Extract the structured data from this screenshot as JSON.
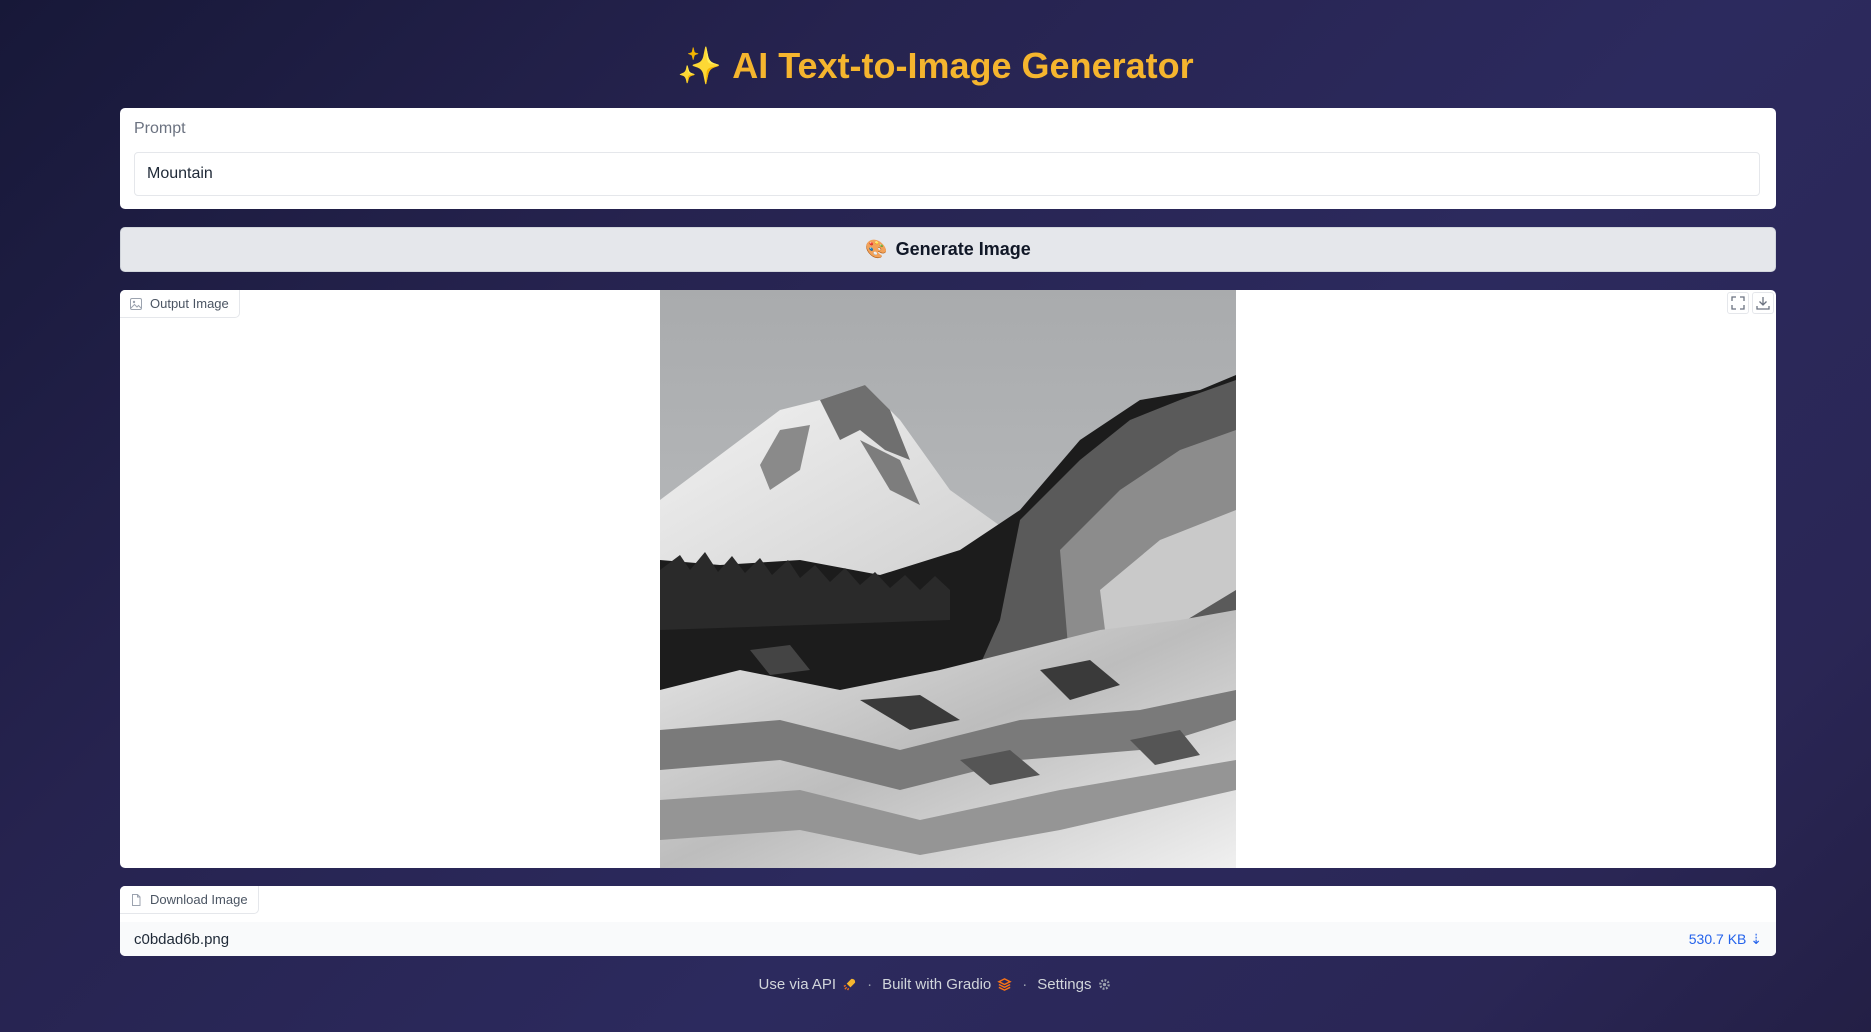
{
  "header": {
    "icon": "sparkles-icon",
    "sparkle": "✨",
    "title": "AI Text-to-Image Generator",
    "title_color": "#f5b52e"
  },
  "prompt": {
    "label": "Prompt",
    "value": "Mountain"
  },
  "generate": {
    "icon": "artist-palette-icon",
    "palette": "🎨",
    "label": "Generate Image"
  },
  "output": {
    "label": "Output Image",
    "label_icon": "image-icon",
    "image_description_icon": "snowy-mountain-image",
    "actions": [
      "fullscreen-icon",
      "download-icon"
    ]
  },
  "download": {
    "label": "Download Image",
    "label_icon": "file-icon",
    "file_name": "c0bdad6b.png",
    "file_size": "530.7 KB ⇣"
  },
  "footer": {
    "api": "Use via API",
    "built": "Built with Gradio",
    "settings": "Settings",
    "separator": "·"
  },
  "colors": {
    "background": "#26234f",
    "accent": "#f5b52e",
    "link": "#2563eb"
  }
}
